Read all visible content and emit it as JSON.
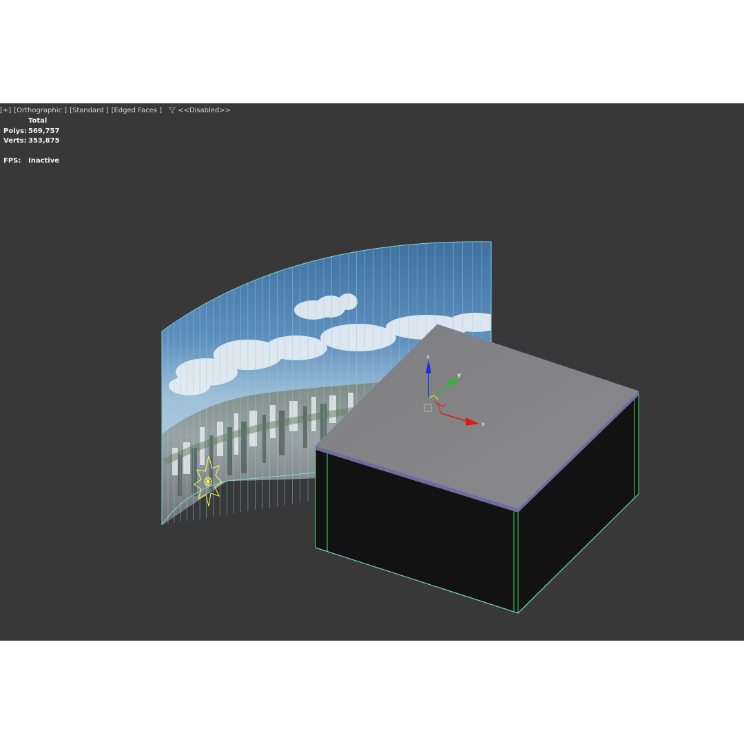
{
  "viewport": {
    "label": {
      "menu": "[+]",
      "view": "[Orthographic ]",
      "shading": "[Standard ]",
      "edges": "[Edged Faces ]",
      "filter_icon": "funnel-icon",
      "filter_status": "<<Disabled>>"
    },
    "stats": {
      "header": "Total",
      "polys_label": "Polys:",
      "polys_value": "569,757",
      "verts_label": "Verts:",
      "verts_value": "353,875",
      "fps_label": "FPS:",
      "fps_value": "Inactive"
    },
    "gizmo": {
      "z_label": "z",
      "y_label": "y",
      "x_label": "x"
    },
    "colors": {
      "background": "#383838",
      "wire_cyan": "#7fd6e8",
      "wire_green": "#3ee36a",
      "light_yellow": "#ffff55",
      "axis_x": "#e01818",
      "axis_y": "#20c020",
      "axis_z": "#1a30e0"
    }
  }
}
